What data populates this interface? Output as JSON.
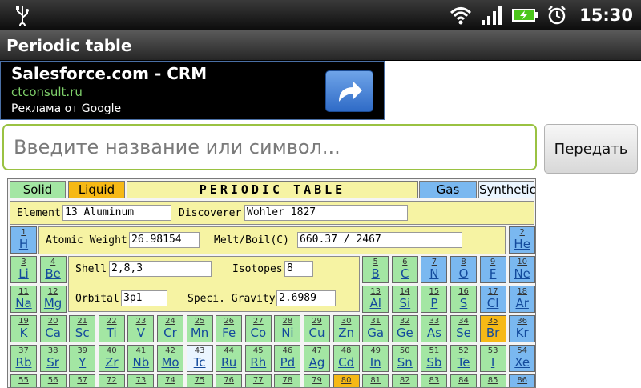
{
  "status": {
    "time": "15:30"
  },
  "app": {
    "title": "Periodic table"
  },
  "ad": {
    "title": "Salesforce.com - CRM",
    "url": "ctconsult.ru",
    "by": "Реклама от Google"
  },
  "search": {
    "placeholder": "Введите название или символ...",
    "button": "Передать"
  },
  "legend": {
    "solid": "Solid",
    "liquid": "Liquid",
    "title": "PERIODIC TABLE",
    "gas": "Gas",
    "synthetic": "Synthetic"
  },
  "info": {
    "element_label": "Element",
    "element_value": "13 Aluminum",
    "discoverer_label": "Discoverer",
    "discoverer_value": "Wohler 1827",
    "weight_label": "Atomic Weight",
    "weight_value": "26.98154",
    "meltboil_label": "Melt/Boil(C)",
    "meltboil_value": "660.37 / 2467",
    "shell_label": "Shell",
    "shell_value": "2,8,3",
    "isotopes_label": "Isotopes",
    "isotopes_value": "8",
    "orbital_label": "Orbital",
    "orbital_value": "3p1",
    "gravity_label": "Speci. Gravity",
    "gravity_value": "2.6989"
  },
  "colors": {
    "solid": "#a3e6a3",
    "liquid": "#f6b916",
    "gas": "#7ab8f0",
    "synthetic": "#eaf5ff",
    "info_bg": "#f6f3a3"
  },
  "elements": [
    {
      "n": "1",
      "s": "H",
      "t": "gas"
    },
    {
      "n": "2",
      "s": "He",
      "t": "gas"
    },
    {
      "n": "3",
      "s": "Li",
      "t": "solid"
    },
    {
      "n": "4",
      "s": "Be",
      "t": "solid"
    },
    {
      "n": "5",
      "s": "B",
      "t": "solid"
    },
    {
      "n": "6",
      "s": "C",
      "t": "solid"
    },
    {
      "n": "7",
      "s": "N",
      "t": "gas"
    },
    {
      "n": "8",
      "s": "O",
      "t": "gas"
    },
    {
      "n": "9",
      "s": "F",
      "t": "gas"
    },
    {
      "n": "10",
      "s": "Ne",
      "t": "gas"
    },
    {
      "n": "11",
      "s": "Na",
      "t": "solid"
    },
    {
      "n": "12",
      "s": "Mg",
      "t": "solid"
    },
    {
      "n": "13",
      "s": "Al",
      "t": "solid"
    },
    {
      "n": "14",
      "s": "Si",
      "t": "solid"
    },
    {
      "n": "15",
      "s": "P",
      "t": "solid"
    },
    {
      "n": "16",
      "s": "S",
      "t": "solid"
    },
    {
      "n": "17",
      "s": "Cl",
      "t": "gas"
    },
    {
      "n": "18",
      "s": "Ar",
      "t": "gas"
    },
    {
      "n": "19",
      "s": "K",
      "t": "solid"
    },
    {
      "n": "20",
      "s": "Ca",
      "t": "solid"
    },
    {
      "n": "21",
      "s": "Sc",
      "t": "solid"
    },
    {
      "n": "22",
      "s": "Ti",
      "t": "solid"
    },
    {
      "n": "23",
      "s": "V",
      "t": "solid"
    },
    {
      "n": "24",
      "s": "Cr",
      "t": "solid"
    },
    {
      "n": "25",
      "s": "Mn",
      "t": "solid"
    },
    {
      "n": "26",
      "s": "Fe",
      "t": "solid"
    },
    {
      "n": "27",
      "s": "Co",
      "t": "solid"
    },
    {
      "n": "28",
      "s": "Ni",
      "t": "solid"
    },
    {
      "n": "29",
      "s": "Cu",
      "t": "solid"
    },
    {
      "n": "30",
      "s": "Zn",
      "t": "solid"
    },
    {
      "n": "31",
      "s": "Ga",
      "t": "solid"
    },
    {
      "n": "32",
      "s": "Ge",
      "t": "solid"
    },
    {
      "n": "33",
      "s": "As",
      "t": "solid"
    },
    {
      "n": "34",
      "s": "Se",
      "t": "solid"
    },
    {
      "n": "35",
      "s": "Br",
      "t": "liquid"
    },
    {
      "n": "36",
      "s": "Kr",
      "t": "gas"
    },
    {
      "n": "37",
      "s": "Rb",
      "t": "solid"
    },
    {
      "n": "38",
      "s": "Sr",
      "t": "solid"
    },
    {
      "n": "39",
      "s": "Y",
      "t": "solid"
    },
    {
      "n": "40",
      "s": "Zr",
      "t": "solid"
    },
    {
      "n": "41",
      "s": "Nb",
      "t": "solid"
    },
    {
      "n": "42",
      "s": "Mo",
      "t": "solid"
    },
    {
      "n": "43",
      "s": "Tc",
      "t": "synthetic"
    },
    {
      "n": "44",
      "s": "Ru",
      "t": "solid"
    },
    {
      "n": "45",
      "s": "Rh",
      "t": "solid"
    },
    {
      "n": "46",
      "s": "Pd",
      "t": "solid"
    },
    {
      "n": "47",
      "s": "Ag",
      "t": "solid"
    },
    {
      "n": "48",
      "s": "Cd",
      "t": "solid"
    },
    {
      "n": "49",
      "s": "In",
      "t": "solid"
    },
    {
      "n": "50",
      "s": "Sn",
      "t": "solid"
    },
    {
      "n": "51",
      "s": "Sb",
      "t": "solid"
    },
    {
      "n": "52",
      "s": "Te",
      "t": "solid"
    },
    {
      "n": "53",
      "s": "I",
      "t": "solid"
    },
    {
      "n": "54",
      "s": "Xe",
      "t": "gas"
    },
    {
      "n": "55",
      "s": "",
      "t": "solid"
    },
    {
      "n": "56",
      "s": "",
      "t": "solid"
    },
    {
      "n": "57",
      "s": "",
      "t": "solid"
    },
    {
      "n": "72",
      "s": "",
      "t": "solid"
    },
    {
      "n": "73",
      "s": "",
      "t": "solid"
    },
    {
      "n": "74",
      "s": "",
      "t": "solid"
    },
    {
      "n": "75",
      "s": "",
      "t": "solid"
    },
    {
      "n": "76",
      "s": "",
      "t": "solid"
    },
    {
      "n": "77",
      "s": "",
      "t": "solid"
    },
    {
      "n": "78",
      "s": "",
      "t": "solid"
    },
    {
      "n": "79",
      "s": "",
      "t": "solid"
    },
    {
      "n": "80",
      "s": "",
      "t": "liquid"
    },
    {
      "n": "81",
      "s": "",
      "t": "solid"
    },
    {
      "n": "82",
      "s": "",
      "t": "solid"
    },
    {
      "n": "83",
      "s": "",
      "t": "solid"
    },
    {
      "n": "84",
      "s": "",
      "t": "solid"
    },
    {
      "n": "85",
      "s": "",
      "t": "solid"
    },
    {
      "n": "86",
      "s": "",
      "t": "gas"
    }
  ]
}
